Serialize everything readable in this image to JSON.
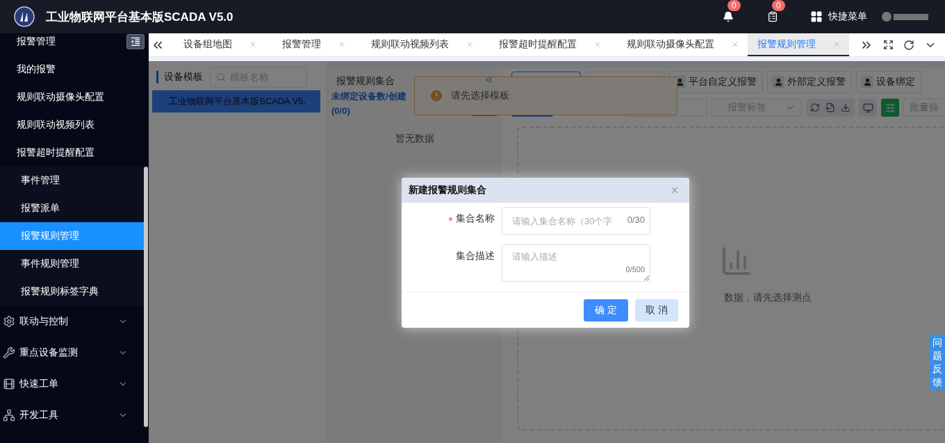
{
  "header": {
    "title": "工业物联网平台基本版SCADA V5.0",
    "badges": [
      "0",
      "0"
    ],
    "quick_menu": "快捷菜单"
  },
  "sidebar": {
    "items": [
      {
        "label": "报警管理",
        "expanded": true,
        "children": [
          {
            "label": "我的报警",
            "selected": false,
            "kind": "page"
          },
          {
            "label": "规则联动摄像头配置",
            "selected": false,
            "kind": "page"
          },
          {
            "label": "规则联动视频列表",
            "selected": false,
            "kind": "page"
          },
          {
            "label": "报警超时提醒配置",
            "selected": false,
            "kind": "page"
          },
          {
            "label": "事件管理",
            "selected": false,
            "kind": "rule"
          },
          {
            "label": "报警派单",
            "selected": false,
            "kind": "rule"
          },
          {
            "label": "报警规则管理",
            "selected": true,
            "kind": "rule"
          },
          {
            "label": "事件规则管理",
            "selected": false,
            "kind": "rule"
          },
          {
            "label": "报警规则标签字典",
            "selected": false,
            "kind": "rule"
          }
        ]
      },
      {
        "label": "联动与控制",
        "expanded": false
      },
      {
        "label": "重点设备监测",
        "expanded": false
      },
      {
        "label": "快速工单",
        "expanded": false
      },
      {
        "label": "开发工具",
        "expanded": false
      }
    ]
  },
  "tabs": [
    {
      "label": "设备组地图",
      "selected": false
    },
    {
      "label": "报警管理",
      "selected": false
    },
    {
      "label": "规则联动视频列表",
      "selected": false
    },
    {
      "label": "报警超时提醒配置",
      "selected": false
    },
    {
      "label": "规则联动摄像头配置",
      "selected": false
    },
    {
      "label": "报警规则管理",
      "selected": true
    }
  ],
  "left_panel": {
    "title": "设备模板",
    "search": {
      "placeholder": "模板名称"
    },
    "tree": [
      {
        "label": "工业物联网平台基本版SCADA V5.",
        "selected": true
      }
    ]
  },
  "middle_panel": {
    "title": "报警规则集合",
    "summary": "未绑定设备数/创建",
    "count": "(0/0)",
    "empty": "暂无数据"
  },
  "right_panel": {
    "buttons": [
      "平台自定义报警",
      "外部定义报警",
      "设备绑定"
    ],
    "tag_select": {
      "placeholder": "报警标签"
    },
    "batch": {
      "placeholder": "批量操"
    },
    "empty": "数据，请先选择测点"
  },
  "message": {
    "text": "请先选择模板"
  },
  "feedback": "问题反馈",
  "dialog": {
    "title": "新建报警规则集合",
    "fields": [
      {
        "label": "集合名称",
        "required": true,
        "kind": "input",
        "placeholder": "请输入集合名称（30个字",
        "counter": "0/30"
      },
      {
        "label": "集合描述",
        "required": false,
        "kind": "textarea",
        "placeholder": "请输入描述",
        "counter": "0/500"
      }
    ],
    "buttons": [
      {
        "label": "确 定",
        "primary": true
      },
      {
        "label": "取 消",
        "primary": false
      }
    ]
  }
}
